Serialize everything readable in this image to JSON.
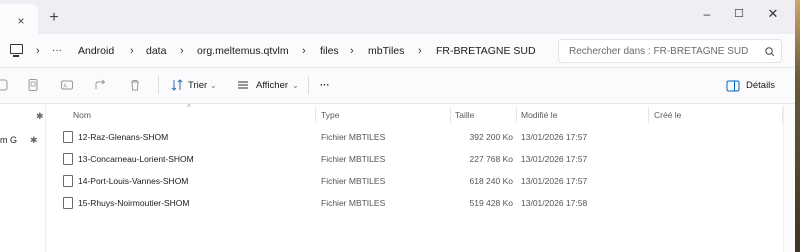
{
  "tabs": {
    "close_glyph": "×",
    "new_tab_glyph": "+"
  },
  "window_controls": {
    "minimize": "–",
    "maximize": "☐",
    "close": "✕"
  },
  "breadcrumb": {
    "overflow": "···",
    "separator": "›",
    "items": [
      "Android",
      "data",
      "org.meltemus.qtvlm",
      "files",
      "mbTiles",
      "FR-BRETAGNE SUD"
    ]
  },
  "search": {
    "placeholder": "Rechercher dans : FR-BRETAGNE SUD"
  },
  "commands": {
    "sort_label": "Trier",
    "view_label": "Afficher",
    "more_label": "···",
    "details_label": "Détails"
  },
  "nav_pane": {
    "partial_item": "m   G"
  },
  "columns": {
    "name": "Nom",
    "type": "Type",
    "size": "Taille",
    "modified": "Modifié le",
    "created": "Créé le"
  },
  "files": [
    {
      "name": "12-Raz-Glenans-SHOM",
      "type": "Fichier MBTILES",
      "size": "392 200 Ko",
      "modified": "13/01/2026 17:57"
    },
    {
      "name": "13-Concarneau-Lorient-SHOM",
      "type": "Fichier MBTILES",
      "size": "227 768 Ko",
      "modified": "13/01/2026 17:57"
    },
    {
      "name": "14-Port-Louis-Vannes-SHOM",
      "type": "Fichier MBTILES",
      "size": "618 240 Ko",
      "modified": "13/01/2026 17:57"
    },
    {
      "name": "15-Rhuys-Noirmoutier-SHOM",
      "type": "Fichier MBTILES",
      "size": "519 428 Ko",
      "modified": "13/01/2026 17:58"
    }
  ],
  "colors": {
    "details_accent": "#0067c0",
    "sort_accent": "#2b6cb0"
  }
}
